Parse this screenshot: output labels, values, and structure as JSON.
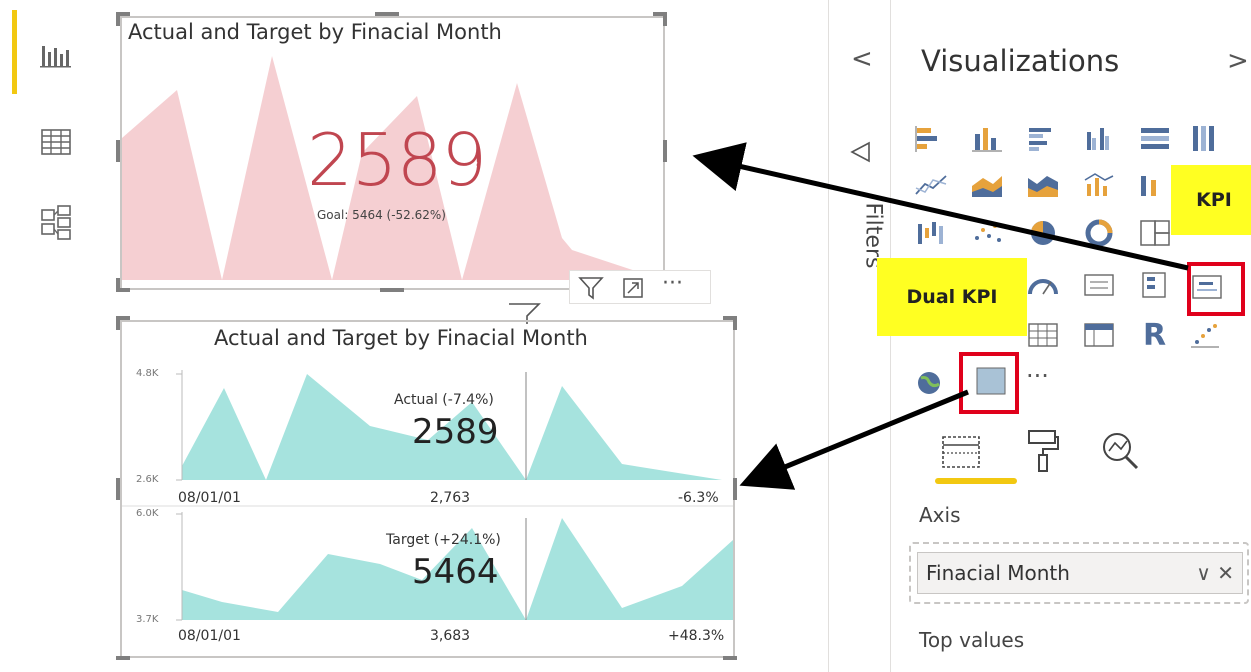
{
  "rail": {
    "items": [
      {
        "name": "report-view-icon"
      },
      {
        "name": "data-view-icon"
      },
      {
        "name": "model-view-icon"
      }
    ]
  },
  "kpi_visual": {
    "title": "Actual and Target by Finacial Month",
    "value": "2589",
    "warning": "!",
    "goal": "Goal: 5464 (-52.62%)"
  },
  "dual_visual": {
    "title": "Actual and Target by Finacial Month",
    "top": {
      "y_max": "4.8K",
      "y_min": "2.6K",
      "label": "Actual (-7.4%)",
      "value": "2589",
      "start_date": "08/01/01",
      "mid_value": "2,763",
      "change": "-6.3%"
    },
    "bottom": {
      "y_max": "6.0K",
      "y_min": "3.7K",
      "label": "Target (+24.1%)",
      "value": "5464",
      "start_date": "08/01/01",
      "mid_value": "3,683",
      "change": "+48.3%"
    }
  },
  "visual_header": {
    "more_label": "···"
  },
  "pane": {
    "collapse_arrow": "<",
    "filters_label": "Filters",
    "viz_title": "Visualizations",
    "expand_arrow": ">",
    "more_visuals": "···",
    "r_visual_label": "R",
    "callout_kpi": "KPI",
    "callout_dual": "Dual KPI",
    "axis_label": "Axis",
    "axis_field": "Finacial Month",
    "axis_field_ctrls": "∨ ✕",
    "top_values_label": "Top values"
  },
  "colors": {
    "accent": "#F2C811",
    "kpi_red": "#C04650",
    "kpi_fill": "#F4CCD0",
    "dual_fill": "#A6E3DE",
    "callout": "#FFFF22",
    "highlight_red": "#E0001B"
  }
}
